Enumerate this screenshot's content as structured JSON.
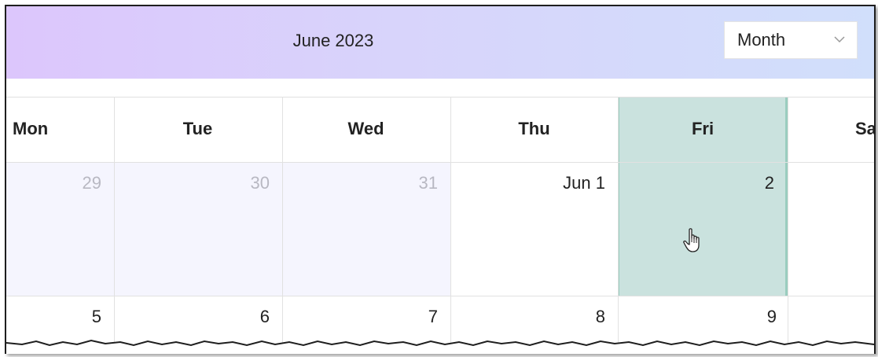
{
  "header": {
    "title": "June 2023",
    "view_select": {
      "value": "Month"
    }
  },
  "weekdays": [
    "Mon",
    "Tue",
    "Wed",
    "Thu",
    "Fri",
    "Sa"
  ],
  "weeks": [
    {
      "days": [
        {
          "label": "29",
          "muted": true
        },
        {
          "label": "30",
          "muted": true
        },
        {
          "label": "31",
          "muted": true
        },
        {
          "label": "Jun 1",
          "muted": false
        },
        {
          "label": "2",
          "muted": false,
          "selected": true
        },
        {
          "label": "",
          "muted": false
        }
      ]
    },
    {
      "days": [
        {
          "label": "5"
        },
        {
          "label": "6"
        },
        {
          "label": "7"
        },
        {
          "label": "8"
        },
        {
          "label": "9"
        },
        {
          "label": ""
        }
      ]
    }
  ],
  "colors": {
    "header_gradient": [
      "#dcc6fc",
      "#d1dffb"
    ],
    "selected_bg": "#cae2de",
    "selected_border": "#9acdbf",
    "other_month_bg": "#f5f5fe",
    "muted_text": "#b8b8c2"
  },
  "icons": {
    "dropdown": "chevron-down-icon",
    "cursor": "hand-pointer-icon"
  }
}
